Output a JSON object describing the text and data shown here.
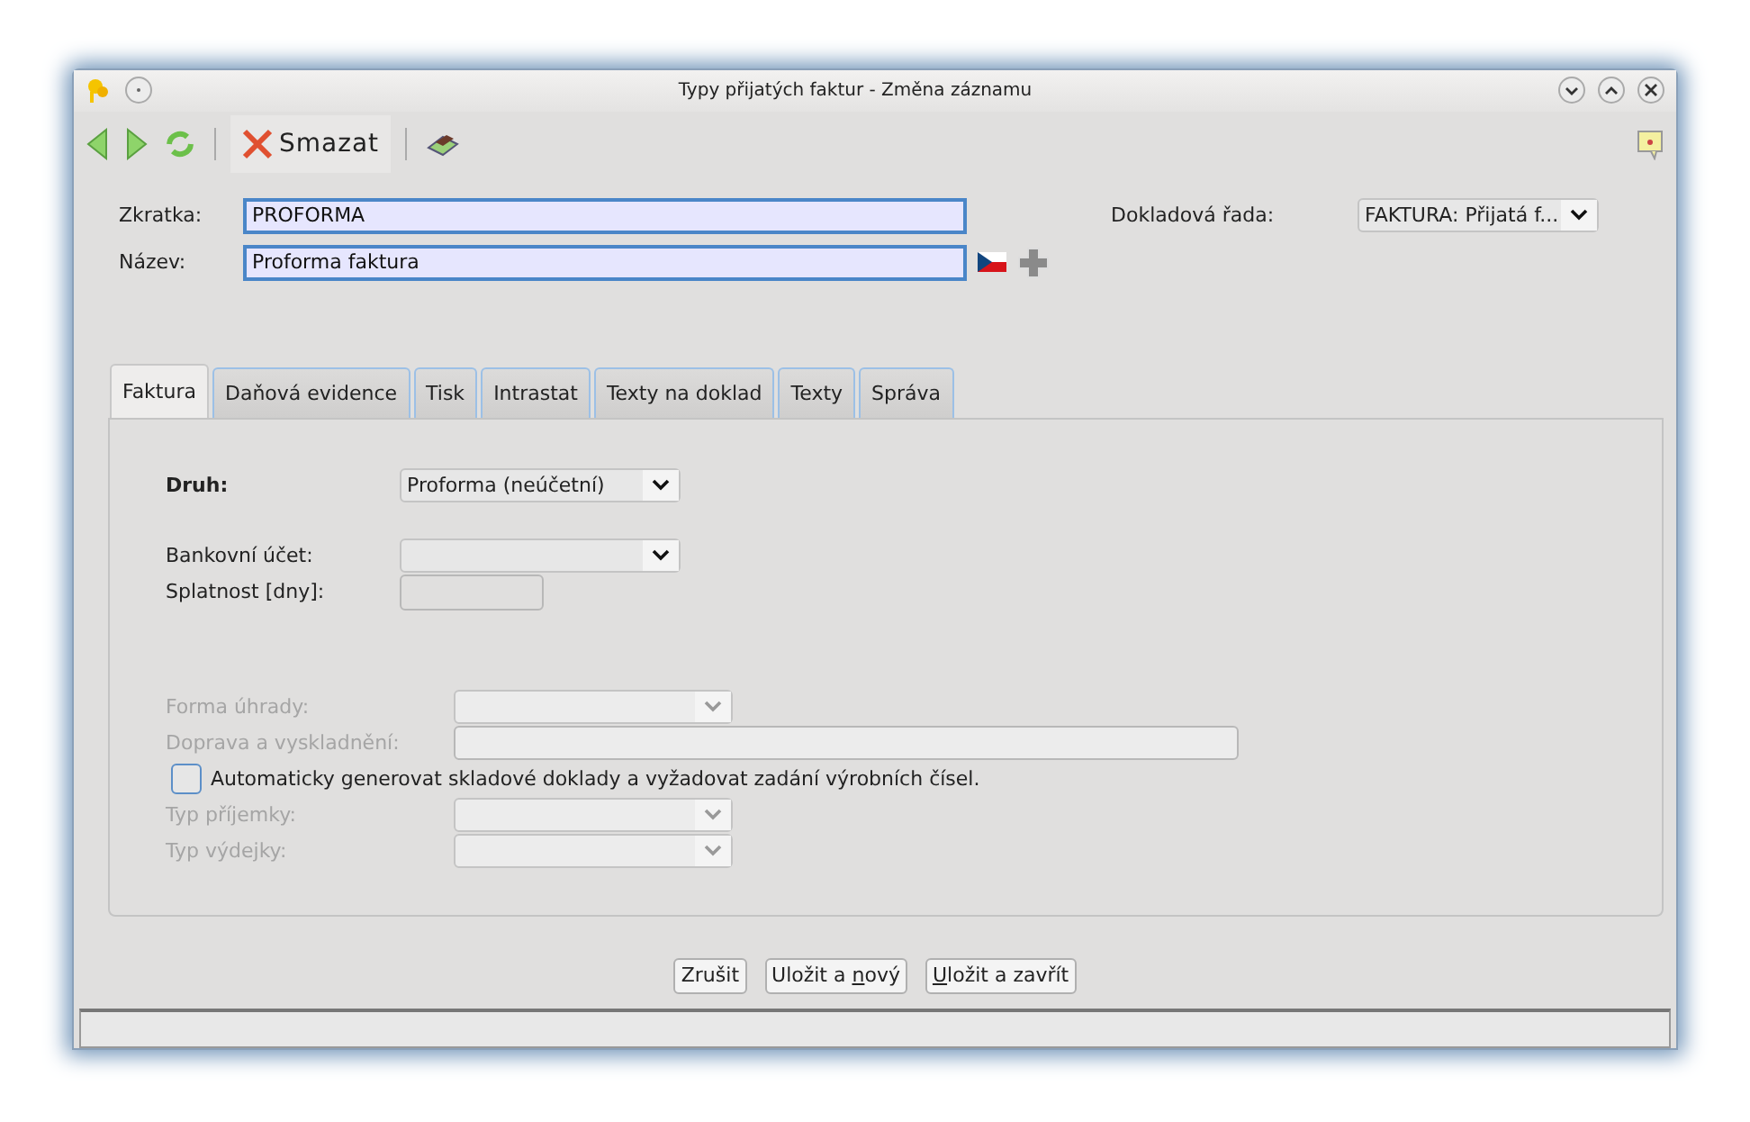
{
  "window": {
    "title": "Typy přijatých faktur - Změna záznamu"
  },
  "toolbar": {
    "delete_label": "Smazat"
  },
  "header": {
    "zkratka_label": "Zkratka:",
    "zkratka_value": "PROFORMA",
    "nazev_label": "Název:",
    "nazev_value": "Proforma faktura",
    "rada_label": "Dokladová řada:",
    "rada_value": "FAKTURA: Přijatá f..."
  },
  "tabs": [
    {
      "label": "Faktura",
      "selected": true
    },
    {
      "label": "Daňová evidence",
      "selected": false
    },
    {
      "label": "Tisk",
      "selected": false
    },
    {
      "label": "Intrastat",
      "selected": false
    },
    {
      "label": "Texty na doklad",
      "selected": false
    },
    {
      "label": "Texty",
      "selected": false
    },
    {
      "label": "Správa",
      "selected": false
    }
  ],
  "rows": [
    {
      "kind": "select",
      "label": "Druh:",
      "bold": true,
      "value": "Proforma (neúčetní)",
      "disabled": false
    },
    {
      "kind": "select",
      "label": "Bankovní účet:",
      "bold": false,
      "disabled": false
    },
    {
      "kind": "input",
      "label": "Splatnost [dny]:",
      "bold": false,
      "disabled": false
    },
    {
      "kind": "select",
      "label": "Forma úhrady:",
      "bold": false,
      "disabled": true
    },
    {
      "kind": "input",
      "label": "Doprava a vyskladnění:",
      "bold": false,
      "disabled": true
    },
    {
      "kind": "checkbox",
      "label": "Automaticky generovat skladové doklady a vyžadovat zadání výrobních čísel.",
      "checked": false
    },
    {
      "kind": "select",
      "label": "Typ příjemky:",
      "bold": false,
      "disabled": true
    },
    {
      "kind": "select",
      "label": "Typ výdejky:",
      "bold": false,
      "disabled": true
    }
  ],
  "buttons": [
    {
      "label": "Zrušit"
    },
    {
      "label": "Uložit a nový"
    },
    {
      "label": "Uložit a zavřít"
    }
  ]
}
